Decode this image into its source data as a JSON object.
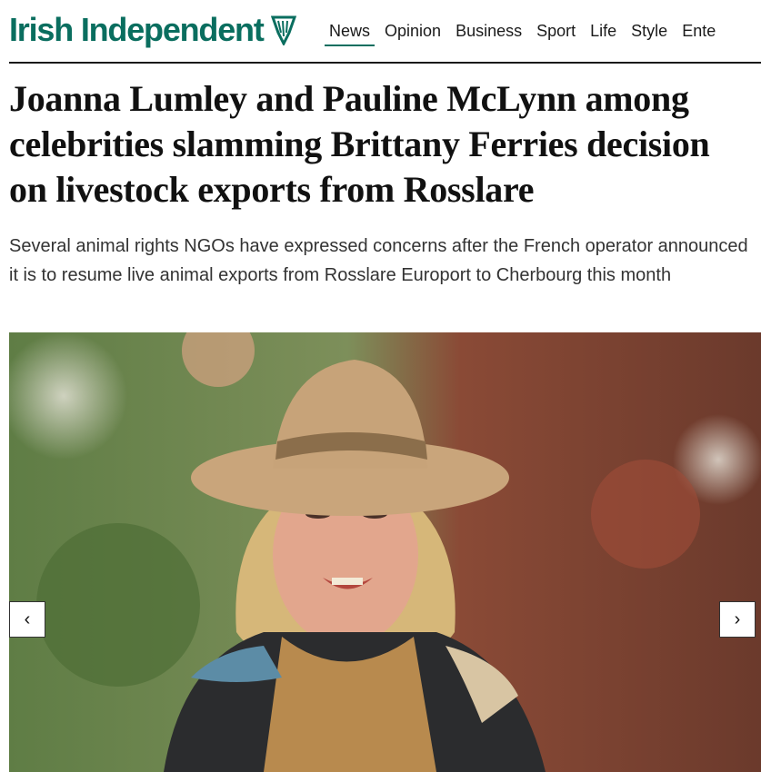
{
  "site": {
    "name": "Irish Independent",
    "logo_icon": "harp-icon",
    "brand_color": "#0a6e5f"
  },
  "nav": {
    "items": [
      "News",
      "Opinion",
      "Business",
      "Sport",
      "Life",
      "Style",
      "Ente"
    ],
    "active": "News"
  },
  "article": {
    "headline": "Joanna Lumley and Pauline McLynn among celebrities slamming Brittany Ferries decision on livestock exports from Rosslare",
    "standfirst": "Several animal rights NGOs have expressed concerns after the French operator announced it is to resume live animal exports from Rosslare Europort to Cherbourg this month"
  },
  "gallery": {
    "prev_icon": "chevron-left-icon",
    "next_icon": "chevron-right-icon",
    "prev_label": "‹",
    "next_label": "›"
  }
}
